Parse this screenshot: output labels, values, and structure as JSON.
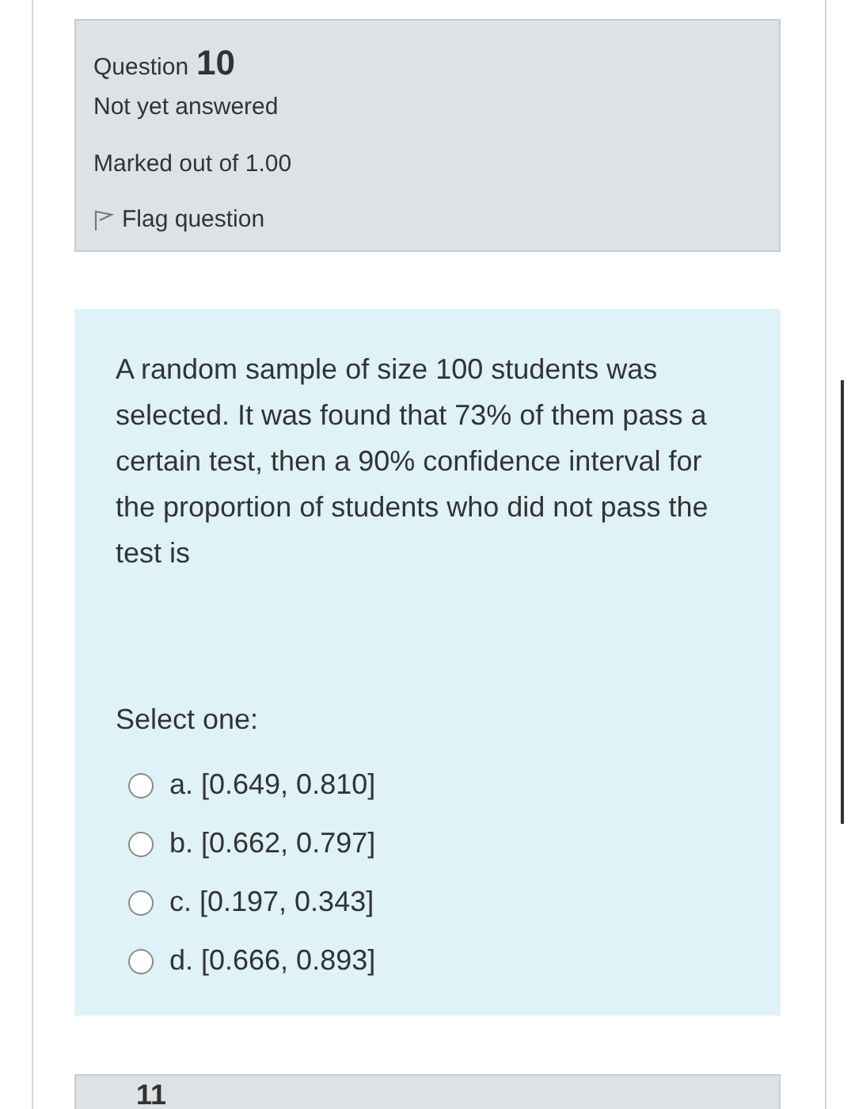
{
  "info": {
    "label": "Question",
    "number": "10",
    "status": "Not yet answered",
    "marks": "Marked out of 1.00",
    "flag": "Flag question"
  },
  "question": {
    "text": "A random sample of size 100 students was selected. It was found that 73% of them pass a certain test, then a 90% confidence interval for the proportion of students who did not pass the test is",
    "prompt": "Select one:",
    "options": [
      {
        "label": "a. [0.649, 0.810]",
        "selected": false
      },
      {
        "label": "b. [0.662, 0.797]",
        "selected": false
      },
      {
        "label": "c. [0.197, 0.343]",
        "selected": false
      },
      {
        "label": "d. [0.666, 0.893]",
        "selected": false
      }
    ]
  },
  "next_question": {
    "number": "11"
  }
}
